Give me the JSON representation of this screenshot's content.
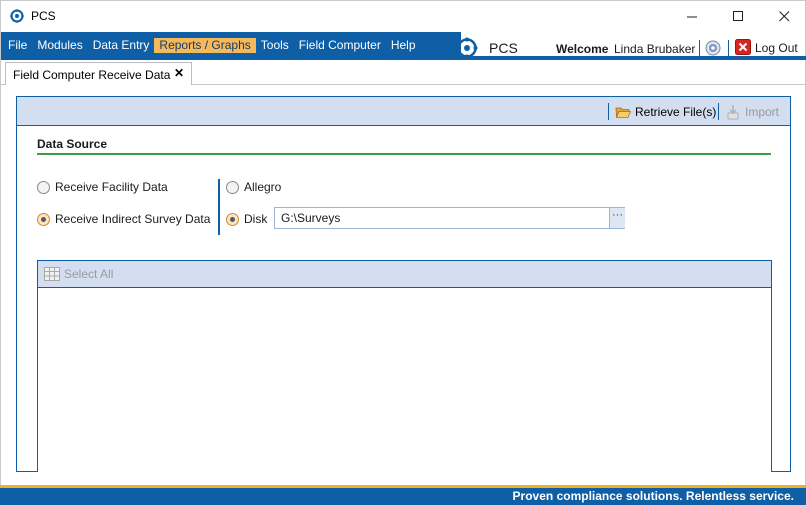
{
  "window": {
    "title": "PCS",
    "controls": {
      "minimize_icon": "minimize-icon",
      "maximize_icon": "maximize-icon",
      "close_icon": "close-icon"
    }
  },
  "menu": {
    "items": [
      "File",
      "Modules",
      "Data Entry",
      "Reports / Graphs",
      "Tools",
      "Field Computer",
      "Help"
    ],
    "active": "Reports / Graphs"
  },
  "header": {
    "brand": "PCS",
    "welcome_label": "Welcome",
    "user_name": "Linda Brubaker",
    "logout_label": "Log Out"
  },
  "tabs": [
    {
      "label": "Field Computer Receive Data",
      "close_glyph": "✕"
    }
  ],
  "toolbar": {
    "retrieve_label": "Retrieve File(s)",
    "import_label": "Import"
  },
  "data_source": {
    "title": "Data Source",
    "options_left": [
      {
        "label": "Receive Facility Data",
        "selected": false
      },
      {
        "label": "Receive Indirect Survey Data",
        "selected": true
      }
    ],
    "options_right": [
      {
        "label": "Allegro",
        "selected": false
      },
      {
        "label": "Disk",
        "selected": true
      }
    ],
    "disk_path": "G:\\Surveys",
    "browse_label": "···"
  },
  "grid": {
    "select_all_label": "Select All"
  },
  "footer": {
    "tagline": "Proven compliance solutions.  Relentless service."
  },
  "colors": {
    "brand_blue": "#0f5fa7",
    "accent_orange": "#f5b95c",
    "accent_green": "#3f9a45",
    "footer_stripe": "#f2b01e"
  }
}
